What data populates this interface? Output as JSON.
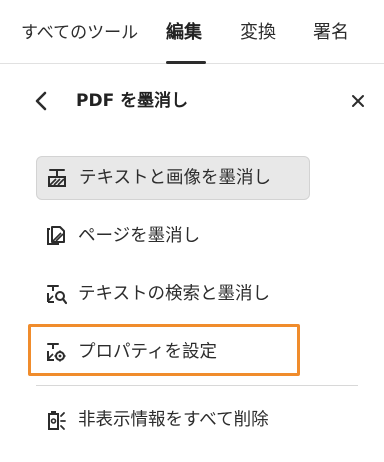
{
  "tabs": [
    {
      "label": "すべてのツール",
      "active": false
    },
    {
      "label": "編集",
      "active": true
    },
    {
      "label": "変換",
      "active": false
    },
    {
      "label": "署名",
      "active": false
    }
  ],
  "panel": {
    "title": "PDF を墨消し",
    "back_icon": "chevron-left-icon",
    "close_icon": "close-icon"
  },
  "menu": [
    {
      "label": "テキストと画像を墨消し",
      "icon": "redact-text-image-icon",
      "selected": true
    },
    {
      "label": "ページを墨消し",
      "icon": "redact-pages-icon",
      "selected": false
    },
    {
      "label": "テキストの検索と墨消し",
      "icon": "find-redact-icon",
      "selected": false
    },
    {
      "label": "プロパティを設定",
      "icon": "redaction-properties-icon",
      "selected": false,
      "highlighted": true
    },
    {
      "label": "非表示情報をすべて削除",
      "icon": "remove-hidden-info-icon",
      "selected": false
    }
  ],
  "colors": {
    "highlight": "#f08c2c",
    "selected_bg": "#e8e8e8",
    "text": "#2c2c2c"
  }
}
